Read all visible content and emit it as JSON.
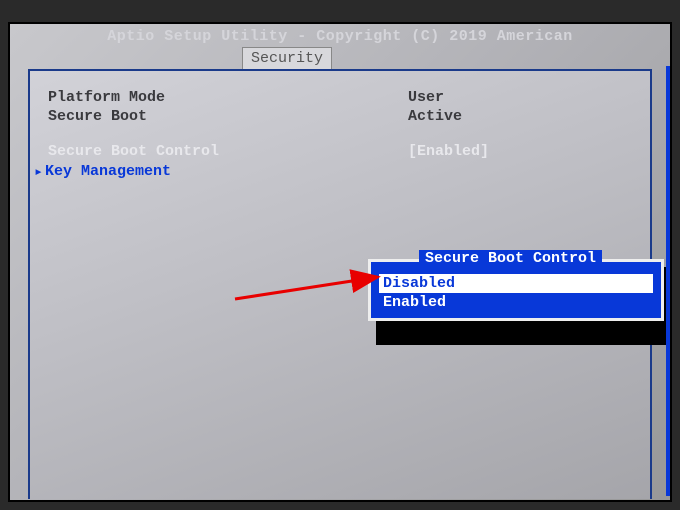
{
  "header": {
    "title": "Aptio Setup Utility - Copyright (C) 2019 American"
  },
  "tabs": {
    "active": "Security"
  },
  "info": {
    "platform_mode_label": "Platform Mode",
    "platform_mode_value": "User",
    "secure_boot_label": "Secure Boot",
    "secure_boot_value": "Active"
  },
  "option": {
    "secure_boot_control_label": "Secure Boot Control",
    "secure_boot_control_value": "[Enabled]"
  },
  "submenu": {
    "key_management": "Key Management"
  },
  "popup": {
    "title": "Secure Boot Control",
    "options": [
      "Disabled",
      "Enabled"
    ],
    "selected_index": 0
  }
}
